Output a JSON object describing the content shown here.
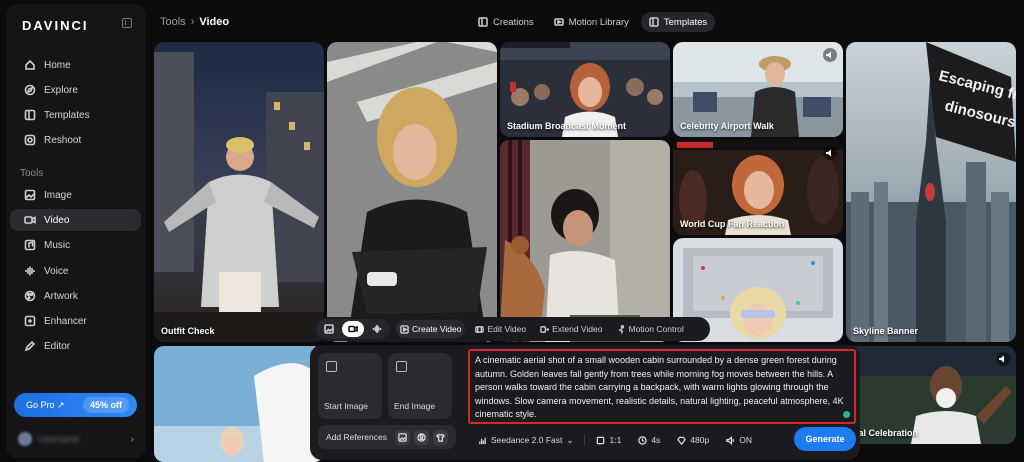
{
  "app": {
    "brand": "DAVINCI"
  },
  "sidebar": {
    "items": [
      {
        "label": "Home",
        "icon": "home-icon"
      },
      {
        "label": "Explore",
        "icon": "explore-icon"
      },
      {
        "label": "Templates",
        "icon": "templates-icon"
      },
      {
        "label": "Reshoot",
        "icon": "reshoot-icon"
      }
    ],
    "section_title": "Tools",
    "tools": [
      {
        "label": "Image",
        "icon": "image-icon"
      },
      {
        "label": "Video",
        "icon": "video-icon",
        "active": true
      },
      {
        "label": "Music",
        "icon": "music-icon"
      },
      {
        "label": "Voice",
        "icon": "voice-icon"
      },
      {
        "label": "Artwork",
        "icon": "artwork-icon"
      },
      {
        "label": "Enhancer",
        "icon": "enhancer-icon"
      },
      {
        "label": "Editor",
        "icon": "editor-icon"
      }
    ],
    "gopro": {
      "label": "Go Pro ↗",
      "badge": "45% off"
    },
    "user": {
      "name": "Username"
    }
  },
  "header": {
    "breadcrumb": {
      "parent": "Tools",
      "separator": "›",
      "current": "Video"
    },
    "tabs": [
      {
        "label": "Creations",
        "icon": "creations-icon"
      },
      {
        "label": "Motion Library",
        "icon": "motion-library-icon"
      },
      {
        "label": "Templates",
        "icon": "templates-icon",
        "active": true
      }
    ]
  },
  "gallery": {
    "cards": [
      {
        "label": "Outfit Check"
      },
      {
        "label": ""
      },
      {
        "label": "Stadium Broadcast Moment"
      },
      {
        "label": "Celebrity Airport Walk"
      },
      {
        "label": "World Cup Fan Reaction"
      },
      {
        "label": "Skyline Banner"
      },
      {
        "label": "Escaping from dinosours"
      },
      {
        "label": "oal Celebration"
      }
    ]
  },
  "modebar": {
    "modes": [
      {
        "label": "Create Video",
        "active": true
      },
      {
        "label": "Edit Video"
      },
      {
        "label": "Extend Video"
      },
      {
        "label": "Motion Control"
      }
    ]
  },
  "composer": {
    "start_image": "Start Image",
    "end_image": "End Image",
    "add_references": "Add References",
    "prompt": "A cinematic aerial shot of a small wooden cabin surrounded by a dense green forest during autumn. Golden leaves fall gently from trees while morning fog moves between the hills. A person walks toward the cabin carrying a backpack, with warm lights glowing through the windows. Slow camera movement, realistic details, natural lighting, peaceful atmosphere, 4K cinematic style.",
    "model": "Seedance 2.0 Fast",
    "aspect": "1:1",
    "duration": "4s",
    "resolution": "480p",
    "audio": "ON",
    "generate": "Generate"
  },
  "colors": {
    "accent": "#1d7cf2",
    "highlight_border": "#d4262b"
  }
}
